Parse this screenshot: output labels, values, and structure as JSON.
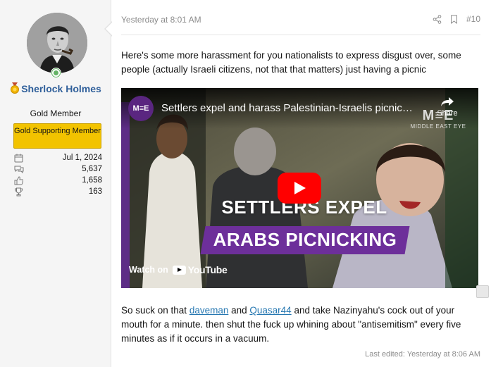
{
  "user": {
    "name": "Sherlock Holmes",
    "title": "Gold Member",
    "banner": "Gold Supporting Member",
    "stats": [
      {
        "icon": "calendar-icon",
        "value": "Jul 1, 2024"
      },
      {
        "icon": "messages-icon",
        "value": "5,637"
      },
      {
        "icon": "reactions-icon",
        "value": "1,658"
      },
      {
        "icon": "trophy-icon",
        "value": "163"
      }
    ]
  },
  "post": {
    "date": "Yesterday at 8:01 AM",
    "number": "#10",
    "intro": "Here's some more harassment for you nationalists to express disgust over, some people (actually Israeli citizens, not that that matters) just having a picnic",
    "video": {
      "channel_logo": "M≡E",
      "title": "Settlers expel and harass Palestinian-Israelis picnic…",
      "share_label": "Share",
      "watermark": "M≡E",
      "watermark_sub": "MIDDLE EAST EYE",
      "headline_line1": "SETTLERS EXPEL",
      "headline_line2": "ARABS PICNICKING",
      "watch_on": "Watch on",
      "youtube": "YouTube"
    },
    "body_part1": "So suck on that ",
    "mention1": "daveman",
    "body_part2": " and ",
    "mention2": "Quasar44",
    "body_part3": " and take Nazinyahu's cock out of your mouth for a minute. then shut the fuck up whining about \"antisemitism\" every five minutes as if it occurs in a vacuum.",
    "last_edited": "Last edited: Yesterday at 8:06 AM"
  },
  "colors": {
    "username": "#2f5f9a",
    "banner": "#f2c300",
    "link": "#2577b1",
    "youtube_red": "#ff0000",
    "mee_purple": "#6d2f9a"
  }
}
